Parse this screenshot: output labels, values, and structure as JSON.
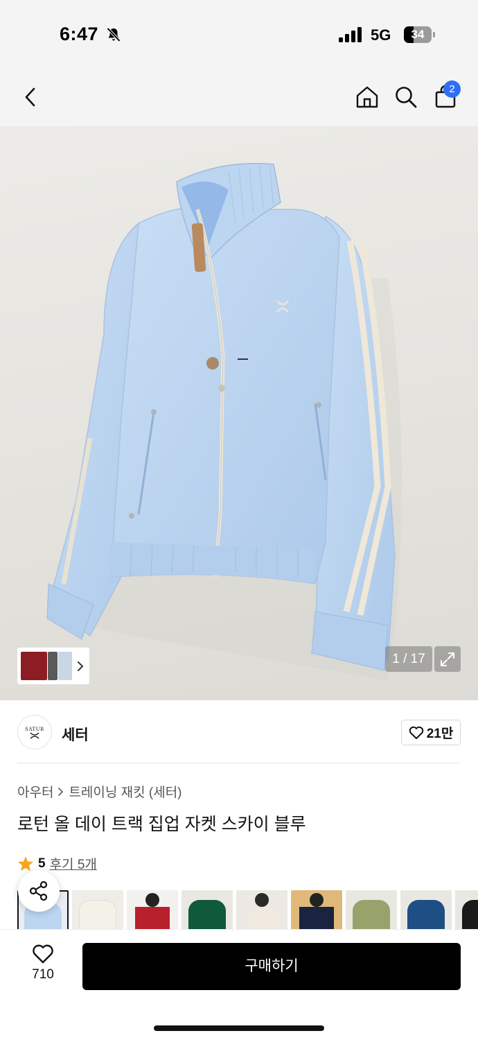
{
  "status_bar": {
    "time": "6:47",
    "network": "5G",
    "battery": "34",
    "icons": [
      "bell-muted-icon",
      "signal-icon",
      "battery-icon"
    ]
  },
  "nav": {
    "icons": [
      "back-icon",
      "home-icon",
      "search-icon",
      "cart-icon"
    ],
    "cart_count": "2"
  },
  "gallery": {
    "counter": "1 / 17",
    "current_image": 1,
    "total_images": 17,
    "icons": [
      "chevron-right-icon",
      "expand-icon"
    ]
  },
  "brand": {
    "logo_text": "SATUR",
    "name": "세터",
    "likes": "21만"
  },
  "product": {
    "breadcrumb": [
      "아우터",
      "트레이닝 재킷 (세터)"
    ],
    "title": "로턴 올 데이 트랙 집업 자켓 스카이 블루",
    "rating": "5",
    "rating_stars": 1,
    "reviews_label": "후기 5개"
  },
  "color_options": {
    "count_visible": 9,
    "selected_index": 0,
    "colors": [
      "#cfe0f4",
      "#f0ede4",
      "#b8202c",
      "#0e5a3a",
      "#efe9e0",
      "#1a2340",
      "#97a36a",
      "#1d4f84",
      "#1a1a1a"
    ]
  },
  "bottom_bar": {
    "wish_count": "710",
    "buy_label": "구매하기"
  },
  "colors": {
    "accent_blue": "#2f6ff5",
    "star": "#f5a623",
    "buy_button": "#000000",
    "jacket": "#bcd5f0"
  }
}
